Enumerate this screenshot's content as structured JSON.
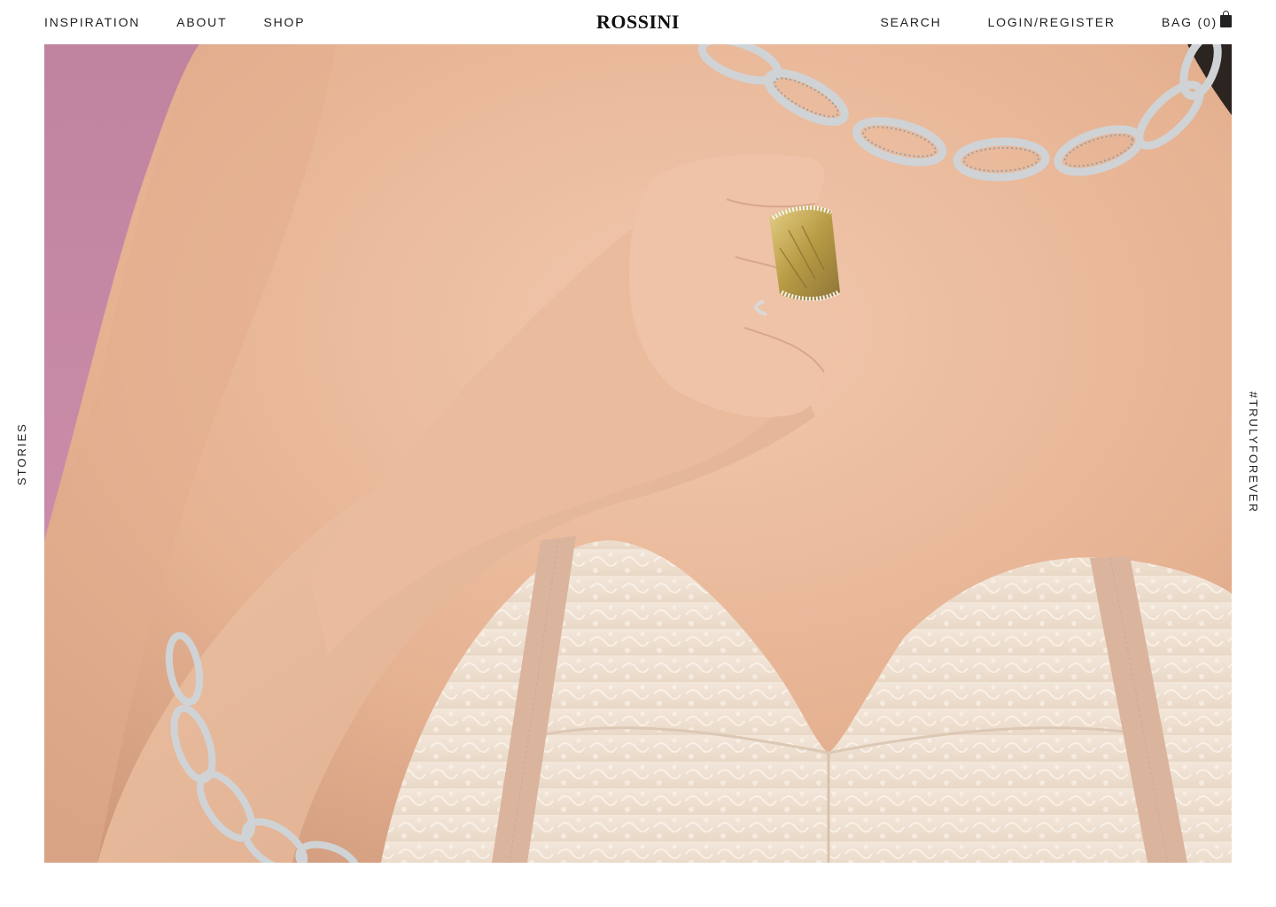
{
  "header": {
    "nav_left": [
      {
        "label": "INSPIRATION"
      },
      {
        "label": "ABOUT"
      },
      {
        "label": "SHOP"
      }
    ],
    "logo": "ROSSINI",
    "nav_right": {
      "search": "SEARCH",
      "login": "LOGIN/REGISTER",
      "bag": "BAG (0)"
    }
  },
  "side": {
    "left": "STORIES",
    "right": "#TRULYFOREVER"
  },
  "hero": {
    "icons": [
      "shopping-bag-icon"
    ],
    "colors": {
      "background_pink": "#c98aa5",
      "skin": "#e8b999",
      "lace": "#efe1d3",
      "ribbon": "#dcb8a2",
      "silver": "#cfd3d6",
      "stone": "#c9b05a"
    }
  }
}
